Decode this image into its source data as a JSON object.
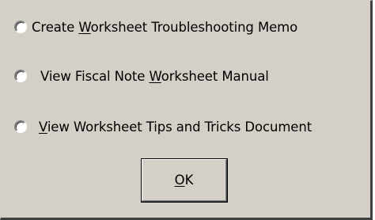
{
  "dialog": {
    "options": [
      {
        "pre": "Create ",
        "accel": "W",
        "post": "orksheet Troubleshooting Memo",
        "selected": false
      },
      {
        "pre": "View Fiscal Note ",
        "accel": "W",
        "post": "orksheet Manual",
        "selected": false
      },
      {
        "pre": "",
        "accel": "V",
        "post": "iew Worksheet Tips and Tricks Document",
        "selected": false
      }
    ],
    "ok_button": {
      "accel": "O",
      "post": "K"
    }
  },
  "colors": {
    "dialog_background": "#d4d0c8",
    "text": "#000000"
  }
}
